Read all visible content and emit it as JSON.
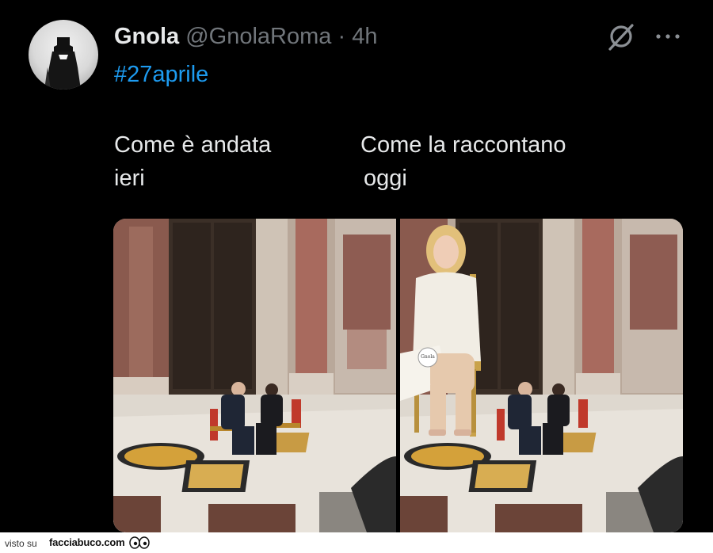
{
  "tweet": {
    "author_name": "Gnola",
    "handle": "@GnolaRoma",
    "separator": "·",
    "time": "4h",
    "hashtag": "#27aprile",
    "left_caption": [
      "Come è andata",
      "ieri"
    ],
    "right_caption": [
      "Come la raccontano",
      "oggi"
    ],
    "badge_text": "Gnola"
  },
  "icons": {
    "grok": "grok-icon",
    "more": "more-icon"
  },
  "footer": {
    "seen_on": "visto su",
    "brand": "facciabuco.com"
  },
  "colors": {
    "background": "#000000",
    "text": "#e7e9ea",
    "muted": "#71767b",
    "link": "#1d9bf0"
  }
}
